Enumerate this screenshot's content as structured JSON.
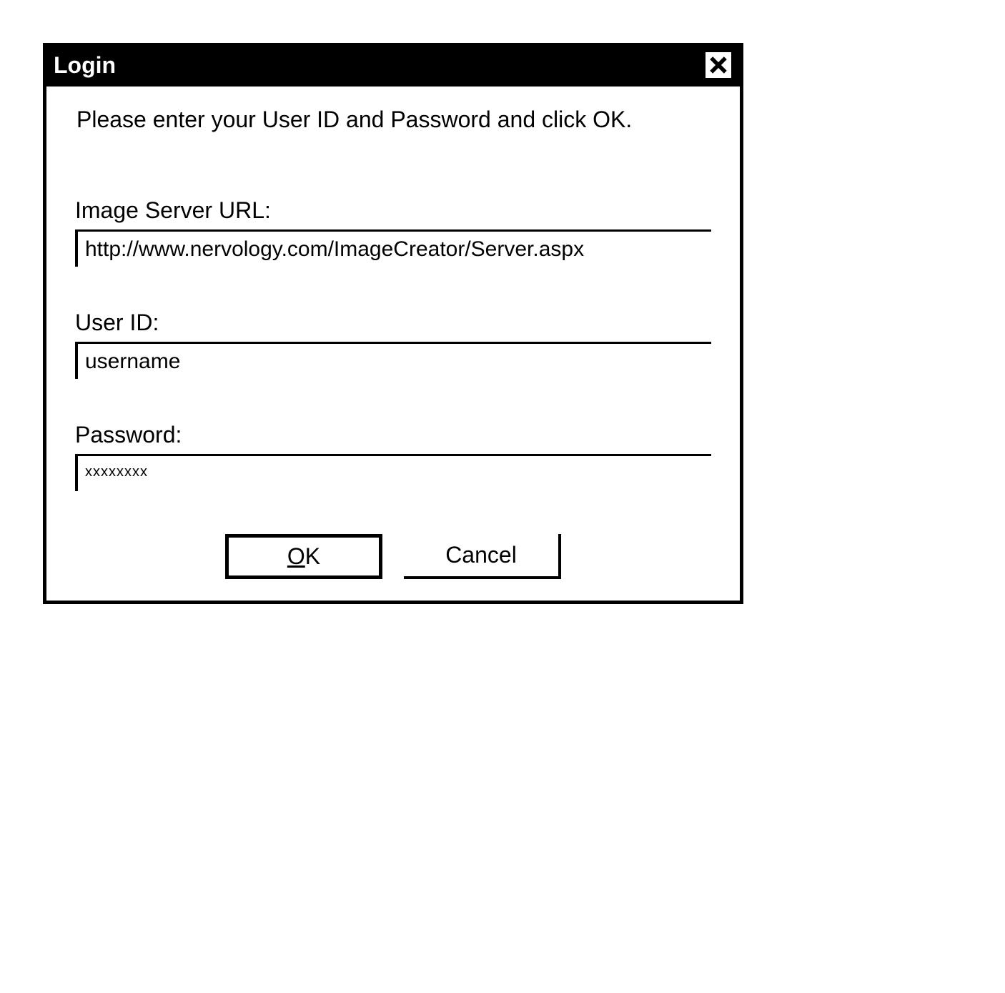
{
  "dialog": {
    "title": "Login",
    "instruction": "Please enter your User ID and Password and click OK.",
    "fields": {
      "server_url": {
        "label": "Image Server URL:",
        "value": "http://www.nervology.com/ImageCreator/Server.aspx"
      },
      "user_id": {
        "label": "User ID:",
        "value": "username"
      },
      "password": {
        "label": "Password:",
        "value": "xxxxxxxx"
      }
    },
    "buttons": {
      "ok": "OK",
      "cancel": "Cancel"
    }
  }
}
